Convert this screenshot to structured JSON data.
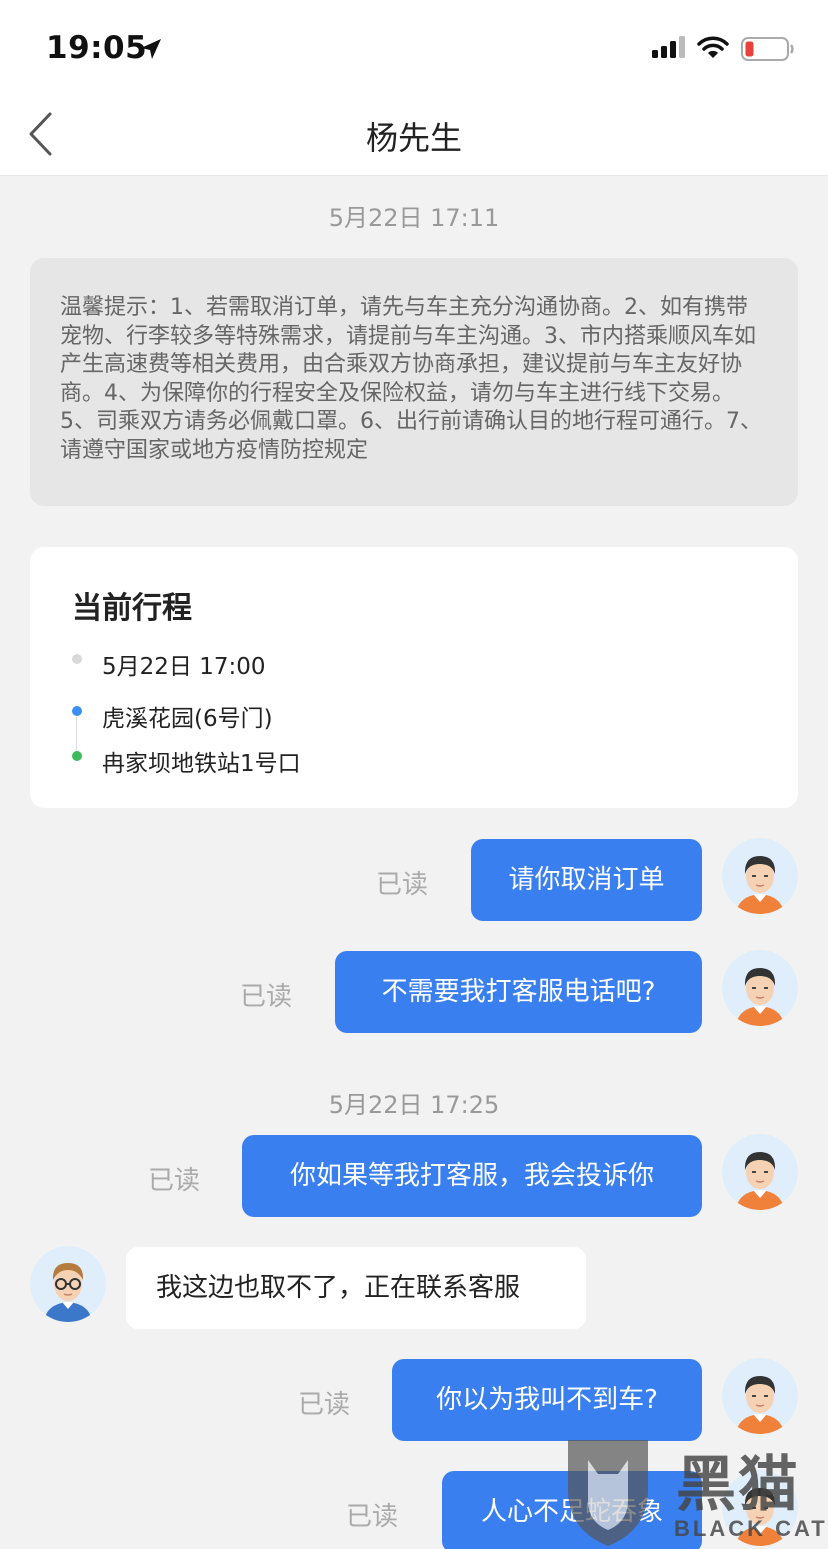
{
  "status": {
    "time": "19:05"
  },
  "nav": {
    "title": "杨先生"
  },
  "timestamps": {
    "first": "5月22日 17:11",
    "second": "5月22日 17:25"
  },
  "notice": {
    "text": "温馨提示：1、若需取消订单，请先与车主充分沟通协商。2、如有携带宠物、行李较多等特殊需求，请提前与车主沟通。3、市内搭乘顺风车如产生高速费等相关费用，由合乘双方协商承担，建议提前与车主友好协商。4、为保障你的行程安全及保险权益，请勿与车主进行线下交易。5、司乘双方请务必佩戴口罩。6、出行前请确认目的地行程可通行。7、请遵守国家或地方疫情防控规定"
  },
  "trip": {
    "title": "当前行程",
    "time": "5月22日 17:00",
    "origin": "虎溪花园(6号门)",
    "destination": "冉家坝地铁站1号口",
    "colors": {
      "time_dot": "#d9d9d9",
      "origin_dot": "#3a8ff0",
      "destination_dot": "#3dbb5a"
    }
  },
  "messages": [
    {
      "side": "out",
      "text": "请你取消订单",
      "status": "已读"
    },
    {
      "side": "out",
      "text": "不需要我打客服电话吧?",
      "status": "已读"
    },
    {
      "side": "out",
      "text": "你如果等我打客服，我会投诉你",
      "status": "已读"
    },
    {
      "side": "in",
      "text": "我这边也取不了，正在联系客服"
    },
    {
      "side": "out",
      "text": "你以为我叫不到车?",
      "status": "已读"
    },
    {
      "side": "out",
      "text": "人心不足蛇吞象",
      "status": "已读"
    }
  ],
  "watermark": {
    "text": "黑猫",
    "sub": "BLACK CAT"
  },
  "colors": {
    "accent": "#3a7ff0",
    "background": "#f2f2f2"
  }
}
